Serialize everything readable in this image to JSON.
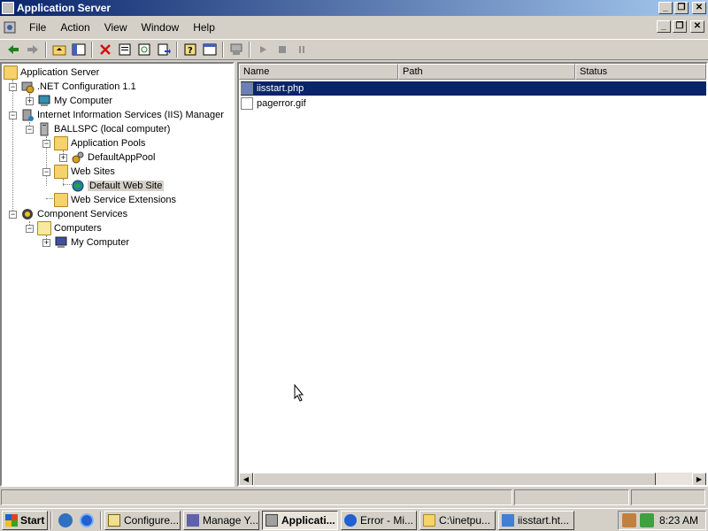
{
  "window": {
    "title": "Application Server"
  },
  "menu": [
    {
      "label": "File"
    },
    {
      "label": "Action"
    },
    {
      "label": "View"
    },
    {
      "label": "Window"
    },
    {
      "label": "Help"
    }
  ],
  "tree": {
    "root": "Application Server",
    "net_config": ".NET Configuration 1.1",
    "net_my_computer": "My Computer",
    "iis_manager": "Internet Information Services (IIS) Manager",
    "ballspc": "BALLSPC (local computer)",
    "app_pools": "Application Pools",
    "default_app_pool": "DefaultAppPool",
    "web_sites": "Web Sites",
    "default_web_site": "Default Web Site",
    "web_service_ext": "Web Service Extensions",
    "component_services": "Component Services",
    "computers": "Computers",
    "cs_my_computer": "My Computer"
  },
  "list": {
    "columns": [
      {
        "label": "Name"
      },
      {
        "label": "Path"
      },
      {
        "label": "Status"
      }
    ],
    "rows": [
      {
        "name": "iisstart.php",
        "selected": true
      },
      {
        "name": "pagerror.gif",
        "selected": false
      }
    ]
  },
  "taskbar": {
    "start": "Start",
    "tasks": [
      {
        "label": "Configure..."
      },
      {
        "label": "Manage Y..."
      },
      {
        "label": "Applicati..."
      },
      {
        "label": "Error - Mi..."
      },
      {
        "label": "C:\\inetpu..."
      },
      {
        "label": "iisstart.ht..."
      }
    ],
    "clock": "8:23 AM"
  },
  "colors": {
    "title_start": "#0a246a",
    "title_end": "#a6caf0",
    "selection": "#0a246a",
    "face": "#d4d0c8"
  }
}
